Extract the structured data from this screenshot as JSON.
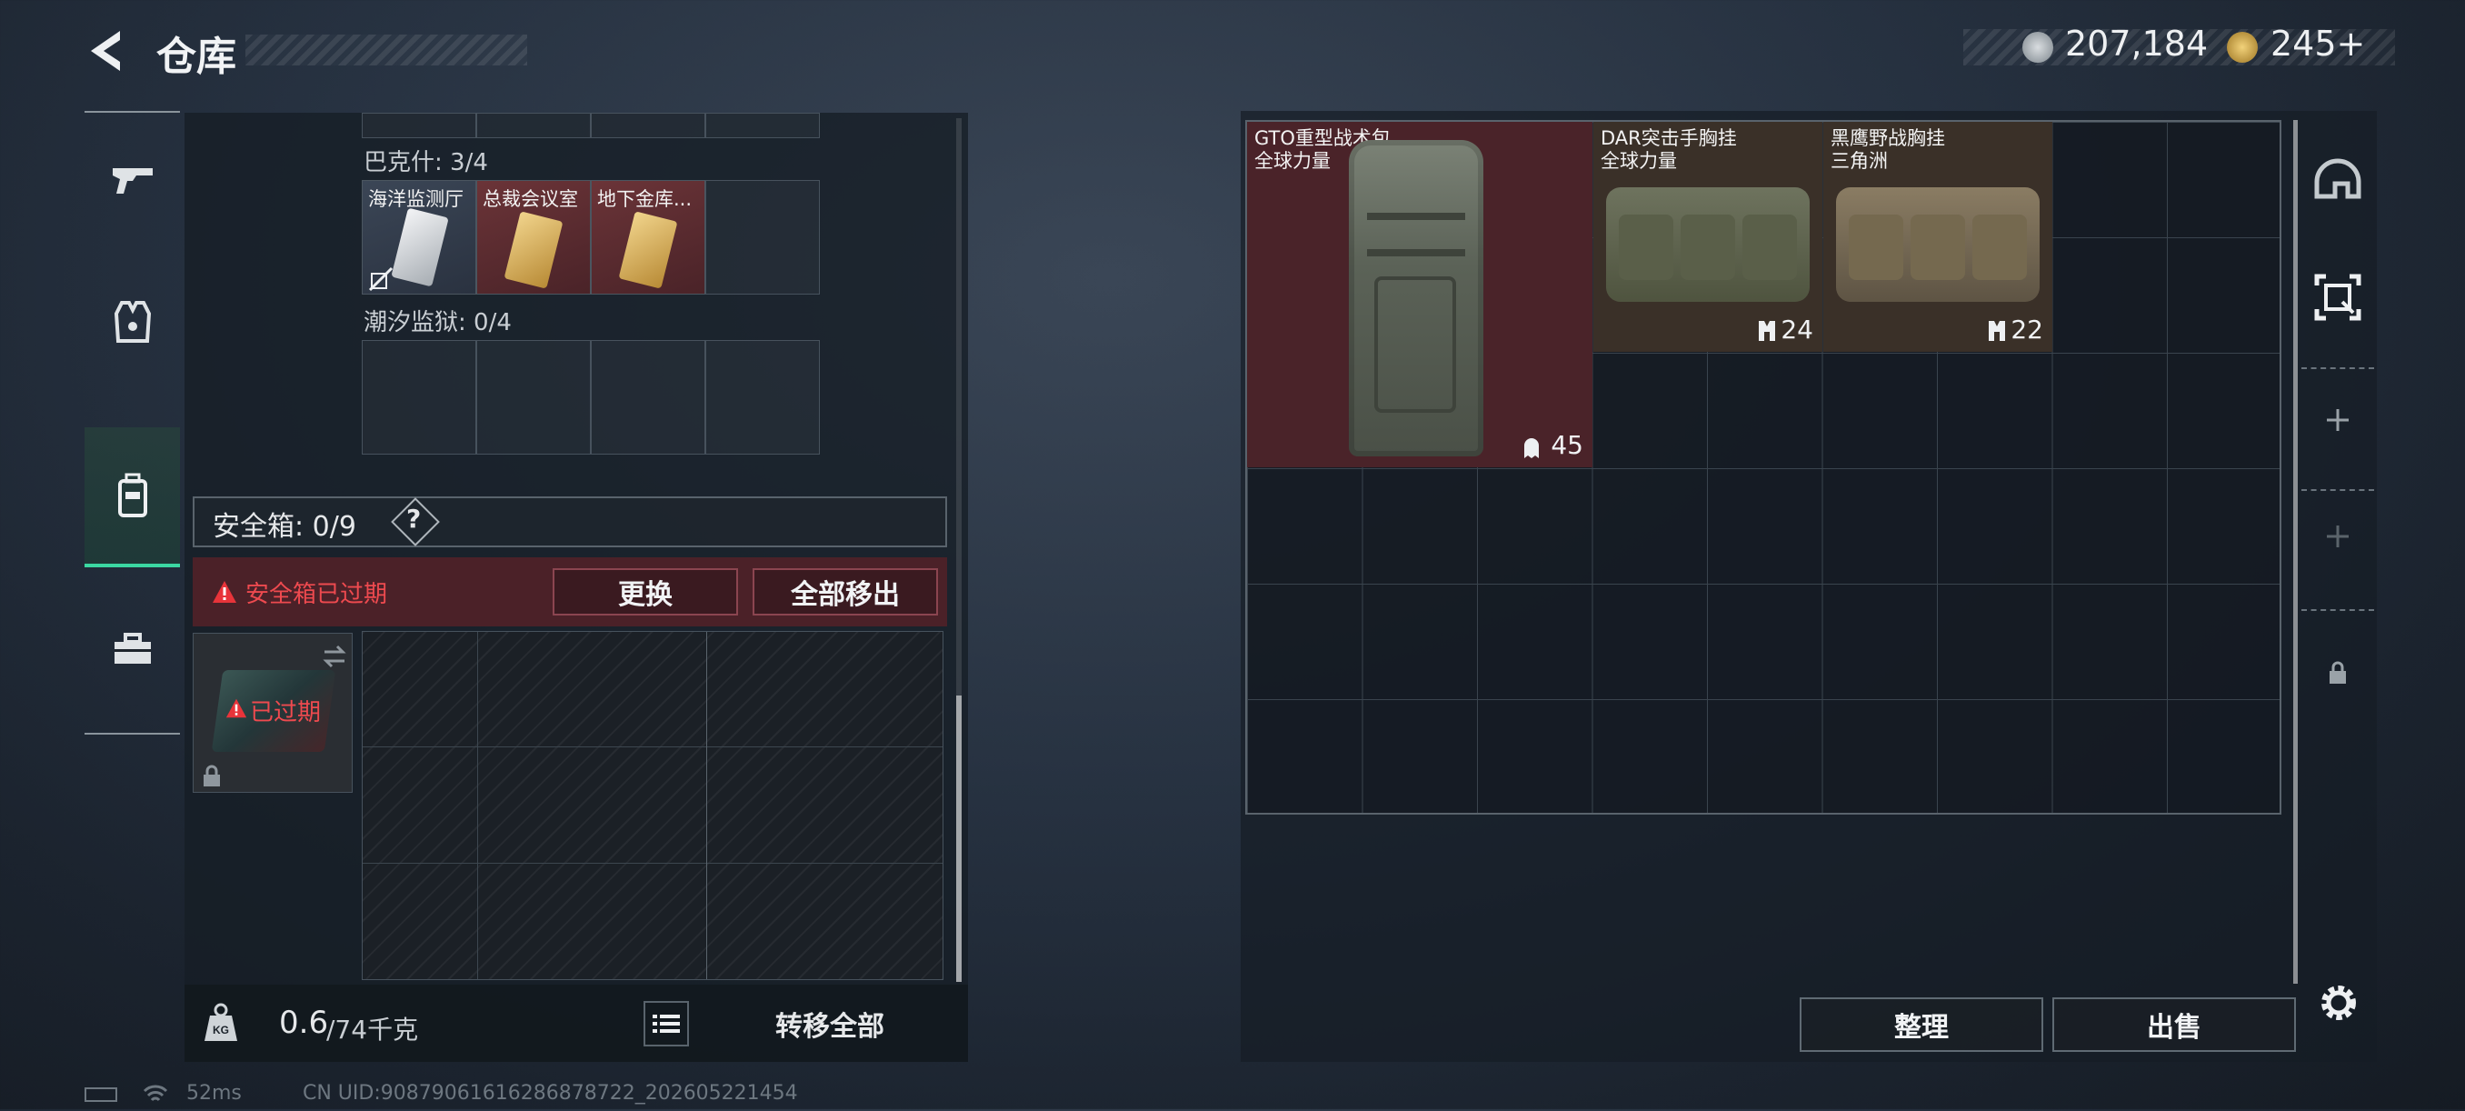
{
  "header": {
    "title": "仓库"
  },
  "currency": {
    "silver_value": "207,184",
    "gold_value": "245+"
  },
  "side_nav": {
    "items": [
      {
        "name": "weapons",
        "icon": "gun-icon"
      },
      {
        "name": "armor",
        "icon": "vest-icon"
      },
      {
        "name": "backpack",
        "icon": "backpack-icon",
        "active": true
      },
      {
        "name": "tools",
        "icon": "toolbox-icon"
      }
    ]
  },
  "left_panel": {
    "bakesh_label": "巴克什: 3/4",
    "keys": [
      {
        "name": "海洋监测厅",
        "style": "silver"
      },
      {
        "name": "总裁会议室",
        "style": "gold"
      },
      {
        "name": "地下金库...",
        "style": "gold"
      }
    ],
    "tidal_label": "潮汐监狱: 0/4",
    "safebox_label": "安全箱: 0/9",
    "safebox_help": "?",
    "expired_warning": "安全箱已过期",
    "replace_btn": "更换",
    "remove_all_btn": "全部移出",
    "safebox_item_status": "已过期",
    "weight_value": "0.6",
    "weight_capacity": "/74千克",
    "transfer_all_btn": "转移全部"
  },
  "storage": {
    "items": [
      {
        "name": "GTO重型战术包",
        "sub": "全球力量",
        "value": "45",
        "bg": "#4a2329"
      },
      {
        "name": "DAR突击手胸挂",
        "sub": "全球力量",
        "value": "24",
        "bg": "#3a3028"
      },
      {
        "name": "黑鹰野战胸挂",
        "sub": "三角洲",
        "value": "22",
        "bg": "#3a3028"
      }
    ],
    "tidy_btn": "整理",
    "sell_btn": "出售"
  },
  "right_nav": {
    "icons": [
      "helmet-icon",
      "scan-icon",
      "plus-icon",
      "plus-icon",
      "lock-icon"
    ]
  },
  "status": {
    "ping": "52ms",
    "uid": "CN UID:9087906161628687872​2_202605221454"
  }
}
